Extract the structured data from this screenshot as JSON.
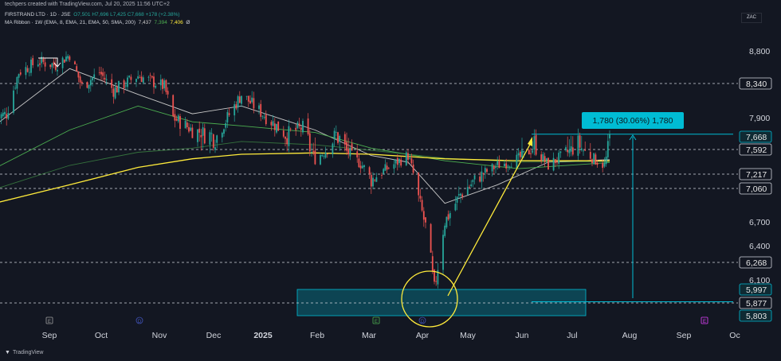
{
  "topbar": {
    "text": "techpers created with TradingView.com, Jul 20, 2025 11:56 UTC+2"
  },
  "legend": {
    "symbol": "FIRSTRAND LTD · 1D · JSE",
    "ohlc": "O7,501 H7,696 L7,425 C7,668 +178 (+2.38%)",
    "ma_title": "MA Ribbon · 1W (EMA, 8, EMA, 21, EMA, 50, SMA, 200)",
    "ma_values": [
      "7,437",
      "7,394",
      "7,406",
      "Ø"
    ]
  },
  "currency": "ZAC",
  "branding": "TradingView",
  "colors": {
    "up": "#26a69a",
    "down": "#ef5350",
    "ma_fast": "#c8c8c8",
    "ma_mid": "#4caf50",
    "ma_slow": "#ffeb3b",
    "accent": "#00bcd4",
    "background": "#131722"
  },
  "chart_data": {
    "type": "candlestick",
    "x_axis": {
      "labels": [
        "Sep",
        "Oct",
        "Nov",
        "Dec",
        "2025",
        "Feb",
        "Mar",
        "Apr",
        "May",
        "Jun",
        "Jul",
        "Aug",
        "Sep",
        "Oc"
      ]
    },
    "y_axis": {
      "labels": [
        "8,800",
        "7,900",
        "6,700",
        "6,400",
        "6,100"
      ],
      "ylim": [
        5780,
        9000
      ]
    },
    "price_labels": [
      {
        "value": 8340,
        "text": "8,340",
        "style": "dark"
      },
      {
        "value": 7668,
        "text": "7,668",
        "style": "accent"
      },
      {
        "value": 7592,
        "text": "7,592",
        "style": "dark"
      },
      {
        "value": 7217,
        "text": "7,217",
        "style": "dark"
      },
      {
        "value": 7060,
        "text": "7,060",
        "style": "dark"
      },
      {
        "value": 6268,
        "text": "6,268",
        "style": "dark"
      },
      {
        "value": 5997,
        "text": "5,997",
        "style": "accent"
      },
      {
        "value": 5877,
        "text": "5,877",
        "style": "dark"
      },
      {
        "value": 5803,
        "text": "5,803",
        "style": "accent"
      }
    ],
    "horizontal_lines": [
      8340,
      7592,
      7217,
      7060,
      6268,
      5877
    ],
    "measure": {
      "from": 5888,
      "to": 7668,
      "label": "1,780 (30.06%) 1,780"
    },
    "demand_zone": {
      "top": 5997,
      "bottom": 5803
    },
    "event_markers": [
      "E",
      "D",
      "E",
      "D",
      "E"
    ],
    "anchors": [
      [
        "2024-08-01",
        7900
      ],
      [
        "2024-08-08",
        7950
      ],
      [
        "2024-08-15",
        8500
      ],
      [
        "2024-08-26",
        8650
      ],
      [
        "2024-09-05",
        8600
      ],
      [
        "2024-09-13",
        8750
      ],
      [
        "2024-09-20",
        8300
      ],
      [
        "2024-09-30",
        8500
      ],
      [
        "2024-10-08",
        8250
      ],
      [
        "2024-10-22",
        8450
      ],
      [
        "2024-11-06",
        8300
      ],
      [
        "2024-11-11",
        7900
      ],
      [
        "2024-11-22",
        7750
      ],
      [
        "2024-12-06",
        7680
      ],
      [
        "2024-12-20",
        8200
      ],
      [
        "2025-01-01",
        7950
      ],
      [
        "2025-01-14",
        7700
      ],
      [
        "2025-01-24",
        7780
      ],
      [
        "2025-01-31",
        7450
      ],
      [
        "2025-02-12",
        7700
      ],
      [
        "2025-02-27",
        7350
      ],
      [
        "2025-03-04",
        7150
      ],
      [
        "2025-03-13",
        7300
      ],
      [
        "2025-03-25",
        7500
      ],
      [
        "2025-03-31",
        6950
      ],
      [
        "2025-04-04",
        6650
      ],
      [
        "2025-04-09",
        6000
      ],
      [
        "2025-04-15",
        6700
      ],
      [
        "2025-04-24",
        7000
      ],
      [
        "2025-05-05",
        7200
      ],
      [
        "2025-05-15",
        7350
      ],
      [
        "2025-05-27",
        7450
      ],
      [
        "2025-06-05",
        7620
      ],
      [
        "2025-06-13",
        7350
      ],
      [
        "2025-06-24",
        7550
      ],
      [
        "2025-07-01",
        7620
      ],
      [
        "2025-07-09",
        7450
      ],
      [
        "2025-07-15",
        7350
      ],
      [
        "2025-07-18",
        7668
      ]
    ],
    "ribbons": [
      {
        "name": "EMA 8",
        "points": [
          [
            "2024-08-01",
            7800
          ],
          [
            "2024-09-13",
            8550
          ],
          [
            "2024-10-22",
            8200
          ],
          [
            "2024-11-22",
            7950
          ],
          [
            "2024-12-20",
            8050
          ],
          [
            "2025-01-31",
            7750
          ],
          [
            "2025-03-04",
            7500
          ],
          [
            "2025-03-25",
            7400
          ],
          [
            "2025-04-15",
            6900
          ],
          [
            "2025-05-15",
            7100
          ],
          [
            "2025-06-13",
            7400
          ],
          [
            "2025-07-18",
            7437
          ]
        ]
      },
      {
        "name": "EMA 21",
        "points": [
          [
            "2024-08-01",
            7300
          ],
          [
            "2024-09-13",
            7750
          ],
          [
            "2024-10-22",
            8050
          ],
          [
            "2024-11-22",
            7850
          ],
          [
            "2024-12-20",
            7800
          ],
          [
            "2025-01-31",
            7720
          ],
          [
            "2025-03-04",
            7600
          ],
          [
            "2025-04-15",
            7420
          ],
          [
            "2025-05-27",
            7300
          ],
          [
            "2025-07-18",
            7394
          ]
        ]
      },
      {
        "name": "EMA 50",
        "points": [
          [
            "2024-08-01",
            7050
          ],
          [
            "2024-09-13",
            7350
          ],
          [
            "2024-10-22",
            7550
          ],
          [
            "2024-11-22",
            7600
          ],
          [
            "2024-12-20",
            7640
          ],
          [
            "2025-01-31",
            7620
          ],
          [
            "2025-03-04",
            7580
          ],
          [
            "2025-04-15",
            7460
          ],
          [
            "2025-05-27",
            7400
          ],
          [
            "2025-07-18",
            7406
          ]
        ]
      },
      {
        "name": "SMA 200",
        "points": [
          [
            "2024-08-01",
            6900
          ],
          [
            "2024-09-13",
            7100
          ],
          [
            "2024-10-22",
            7320
          ],
          [
            "2024-11-22",
            7450
          ],
          [
            "2024-12-20",
            7520
          ],
          [
            "2025-01-31",
            7540
          ],
          [
            "2025-03-04",
            7520
          ],
          [
            "2025-04-15",
            7450
          ],
          [
            "2025-05-27",
            7420
          ],
          [
            "2025-07-18",
            7420
          ]
        ]
      }
    ]
  }
}
